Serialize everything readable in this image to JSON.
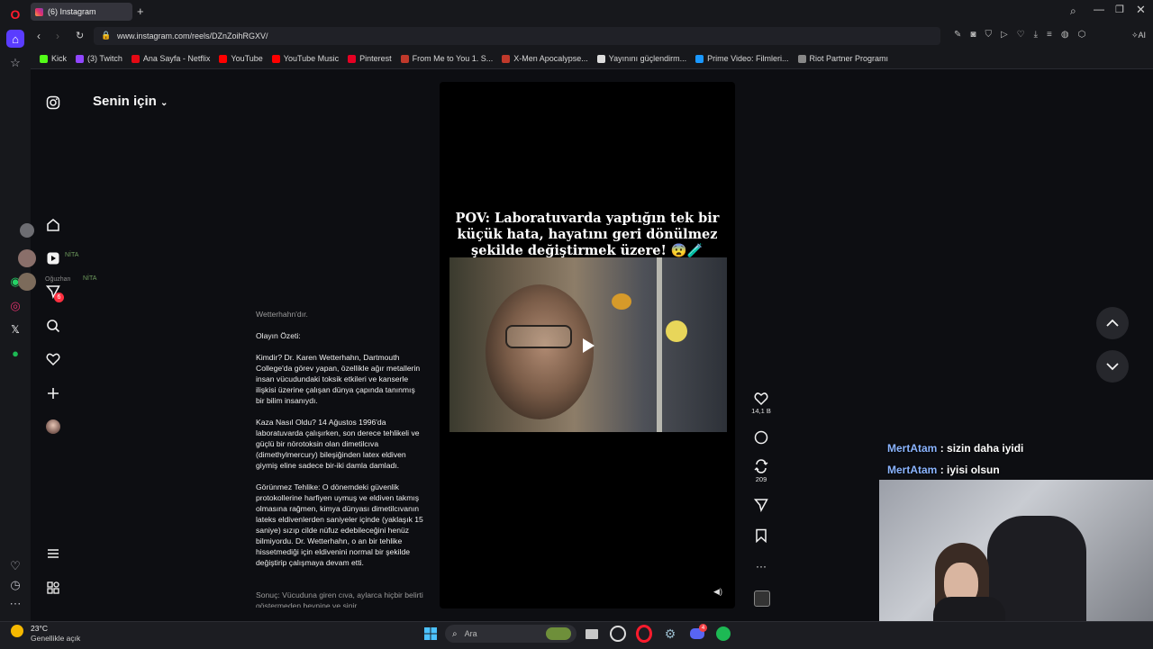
{
  "browser": {
    "tab_title": "(6) Instagram",
    "new_tab_label": "+",
    "url": "www.instagram.com/reels/DZnZoihRGXV/",
    "ai_label": "AI"
  },
  "bookmarks": [
    {
      "label": "Kick",
      "color": "#53fc18"
    },
    {
      "label": "(3) Twitch",
      "color": "#9146ff"
    },
    {
      "label": "Ana Sayfa - Netflix",
      "color": "#e50914"
    },
    {
      "label": "YouTube",
      "color": "#ff0000"
    },
    {
      "label": "YouTube Music",
      "color": "#ff0000"
    },
    {
      "label": "Pinterest",
      "color": "#e60023"
    },
    {
      "label": "From Me to You 1. S...",
      "color": "#c0392b"
    },
    {
      "label": "X-Men Apocalypse...",
      "color": "#c0392b"
    },
    {
      "label": "Yayınını güçlendirm...",
      "color": "#dddddd"
    },
    {
      "label": "Prime Video: Filmleri...",
      "color": "#1a98ff"
    },
    {
      "label": "Riot Partner Programı",
      "color": "#888888"
    }
  ],
  "sidebar_overlay": {
    "user1_tag": "NİTA",
    "user2_name": "Oğuzhan",
    "user2_tag": "NİTA",
    "notification_count": "6"
  },
  "instagram": {
    "feed_title": "Senin için",
    "caption_lines": {
      "head": "Wetterhahn'dır.",
      "p1": "Olayın Özeti:",
      "p2": "Kimdir? Dr. Karen Wetterhahn, Dartmouth College'da görev yapan, özellikle ağır metallerin insan vücudundaki toksik etkileri ve kanserle ilişkisi üzerine çalışan dünya çapında tanınmış bir bilim insanıydı.",
      "p3": "Kaza Nasıl Oldu? 14 Ağustos 1996'da laboratuvarda çalışırken, son derece tehlikeli ve güçlü bir nörotoksin olan dimetilcıva (dimethylmercury) bileşiğinden latex eldiven giymiş eline sadece bir-iki damla damladı.",
      "p4": "Görünmez Tehlike: O dönemdeki güvenlik protokollerine harfiyen uymuş ve eldiven takmış olmasına rağmen, kimya dünyası dimetilcıvanın lateks eldivenlerden saniyeler içinde (yaklaşık 15 saniye) sızıp cilde nüfuz edebileceğini henüz bilmiyordu. Dr. Wetterhahn, o an bir tehlike hissetmediği için eldivenini normal bir şekilde değiştirip çalışmaya devam etti.",
      "p5": "Sonuç: Vücuduna giren cıva, aylarca hiçbir belirti göstermeden beynine ve sinir"
    },
    "reel_text": "POV: Laboratuvarda yaptığın tek bir küçük hata, hayatını geri dönülmez şekilde değiştirmek üzere! 😨🧪",
    "likes": "14,1 B",
    "reposts": "209"
  },
  "chat": [
    {
      "user": "MertAtam",
      "message": ": sizin daha iyidi"
    },
    {
      "user": "MertAtam",
      "message": ": iyisi olsun"
    }
  ],
  "taskbar": {
    "temperature": "23°C",
    "weather": "Genellikle açık",
    "search_placeholder": "Ara",
    "discord_badge": "4"
  }
}
